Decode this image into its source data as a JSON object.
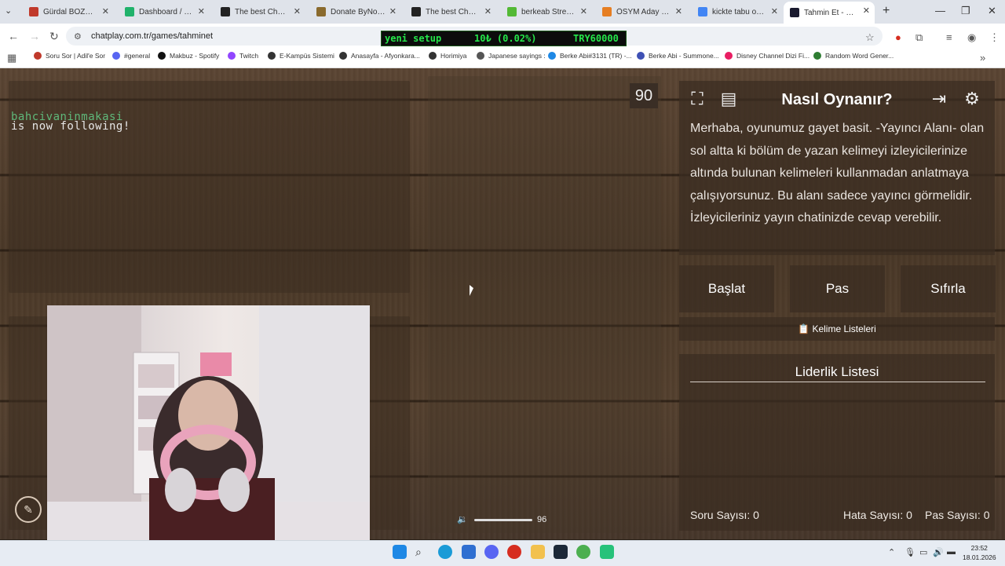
{
  "browser": {
    "tabs": [
      {
        "label": "Gürdal BOZOK#19...",
        "color": "#c0392b"
      },
      {
        "label": "Dashboard / Stream...",
        "color": "#20b26b"
      },
      {
        "label": "The best ChatBot a...",
        "color": "#222222"
      },
      {
        "label": "Donate ByNoGame",
        "color": "#8a6a2d"
      },
      {
        "label": "The best ChatBot a...",
        "color": "#222222"
      },
      {
        "label": "berkeab Stream - V...",
        "color": "#53b935"
      },
      {
        "label": "ÖSYM Aday İşlemle...",
        "color": "#e67e22"
      },
      {
        "label": "kickte tabu oyna - G...",
        "color": "#4285f4"
      },
      {
        "label": "Tahmin Et - ChatPla...",
        "color": "#1a1a2e"
      }
    ],
    "url": "chatplay.com.tr/games/tahminet",
    "ticker": {
      "left": "yeni setup",
      "mid": "10₺ (0.02%)",
      "right": "TRY60000"
    },
    "bookmarks": [
      {
        "label": "Soru Sor | Adil'e Sor",
        "color": "#c0392b"
      },
      {
        "label": "#general",
        "color": "#5865f2"
      },
      {
        "label": "Makbuz - Spotify",
        "color": "#111111"
      },
      {
        "label": "Twitch",
        "color": "#9146ff"
      },
      {
        "label": "E-Kampüs Sistemi",
        "color": "#333333"
      },
      {
        "label": "Anasayfa - Afyonkara...",
        "color": "#333333"
      },
      {
        "label": "Horimiya",
        "color": "#333333"
      },
      {
        "label": "Japanese sayings :",
        "color": "#555555"
      },
      {
        "label": "Berke Abi#3131 (TR) -...",
        "color": "#1e88e5"
      },
      {
        "label": "Berke Abi - Summone...",
        "color": "#3f51b5"
      },
      {
        "label": "Disney Channel Dizi Fi...",
        "color": "#e91e63"
      },
      {
        "label": "Random Word Gener...",
        "color": "#2e7d32"
      }
    ]
  },
  "game": {
    "alert": {
      "user": "bahcivaninmakasi",
      "text": "is now following!"
    },
    "timer": "90",
    "volume": "96",
    "howto": {
      "title": "Nasıl Oynanır?",
      "text": "Merhaba, oyunumuz gayet basit. -Yayıncı Alanı- olan sol altta ki bölüm de yazan kelimeyi izleyicilerinize altında bulunan kelimeleri kullanmadan anlatmaya çalışıyorsunuz. Bu alanı sadece yayıncı görmelidir. İzleyicileriniz yayın chatinizde cevap verebilir."
    },
    "buttons": {
      "start": "Başlat",
      "pass": "Pas",
      "reset": "Sıfırla"
    },
    "word_lists": "📋 Kelime Listeleri",
    "leaderboard": {
      "title": "Liderlik Listesi"
    },
    "stats": {
      "questions": "Soru Sayısı: 0",
      "errors": "Hata Sayısı: 0",
      "passes": "Pas Sayısı: 0"
    }
  },
  "taskbar": {
    "time": "23:52",
    "date": "18.01.2026"
  }
}
